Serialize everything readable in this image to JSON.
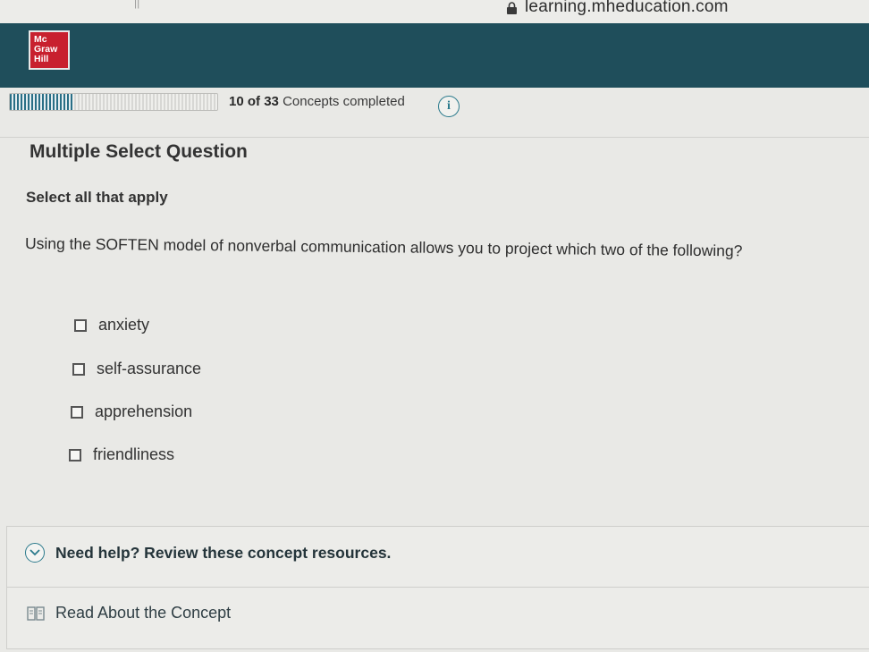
{
  "browser": {
    "url": "learning.mheducation.com",
    "tab_glyph": "||"
  },
  "header": {
    "logo_lines": [
      "Mc",
      "Graw",
      "Hill"
    ],
    "background_color": "#1f4e5b",
    "logo_color": "#c8202e"
  },
  "progress": {
    "completed": "10",
    "total": "33",
    "of_label": "of",
    "suffix": "Concepts completed",
    "fraction": 0.303,
    "info_icon_glyph": "i"
  },
  "question": {
    "type_label": "Multiple Select Question",
    "instruction": "Select all that apply",
    "prompt": "Using the SOFTEN model of nonverbal communication allows you to project which two of the following?",
    "options": [
      {
        "label": "anxiety",
        "checked": false
      },
      {
        "label": "self-assurance",
        "checked": false
      },
      {
        "label": "apprehension",
        "checked": false
      },
      {
        "label": "friendliness",
        "checked": false
      }
    ]
  },
  "help": {
    "toggle_label": "Need help? Review these concept resources.",
    "resource_label": "Read About the Concept",
    "accent_color": "#2b7a8c"
  }
}
